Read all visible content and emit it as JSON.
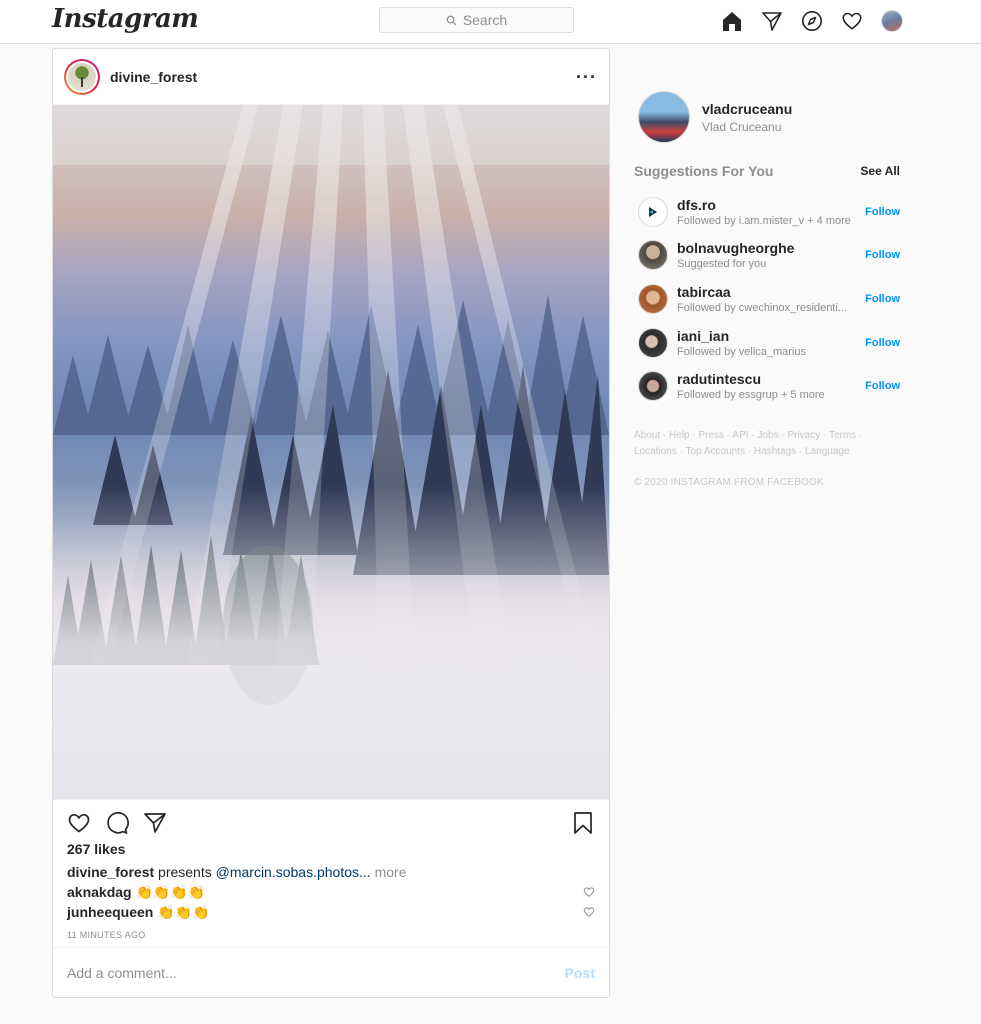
{
  "nav": {
    "logo": "Instagram",
    "search_placeholder": "Search",
    "icons": [
      "home-icon",
      "direct-icon",
      "explore-icon",
      "activity-heart-icon",
      "profile-avatar"
    ]
  },
  "post": {
    "username": "divine_forest",
    "likes": "267 likes",
    "caption": {
      "user": "divine_forest",
      "text": "presents",
      "mention": "@marcin.sobas.photos...",
      "more": "more"
    },
    "comments": [
      {
        "user": "aknakdag",
        "text": "👏👏👏👏"
      },
      {
        "user": "junheequeen",
        "text": "👏👏👏"
      }
    ],
    "timestamp": "11 MINUTES AGO",
    "comment_placeholder": "Add a comment...",
    "post_button": "Post"
  },
  "sidebar": {
    "username": "vladcruceanu",
    "full_name": "Vlad Cruceanu",
    "suggestions_title": "Suggestions For You",
    "see_all": "See All",
    "suggestions": [
      {
        "user": "dfs.ro",
        "sub": "Followed by i.am.mister_v + 4 more",
        "follow": "Follow"
      },
      {
        "user": "bolnavugheorghe",
        "sub": "Suggested for you",
        "follow": "Follow"
      },
      {
        "user": "tabircaa",
        "sub": "Followed by cwechinox_residenti...",
        "follow": "Follow"
      },
      {
        "user": "iani_ian",
        "sub": "Followed by velica_marius",
        "follow": "Follow"
      },
      {
        "user": "radutintescu",
        "sub": "Followed by essgrup + 5 more",
        "follow": "Follow"
      }
    ],
    "footer_links": [
      "About",
      "Help",
      "Press",
      "API",
      "Jobs",
      "Privacy",
      "Terms",
      "Locations",
      "Top Accounts",
      "Hashtags",
      "Language"
    ],
    "copyright": "© 2020 INSTAGRAM FROM FACEBOOK"
  },
  "colors": {
    "accent": "#0095f6",
    "border": "#dbdbdb",
    "muted": "#8e8e8e",
    "background": "#fafafa"
  }
}
